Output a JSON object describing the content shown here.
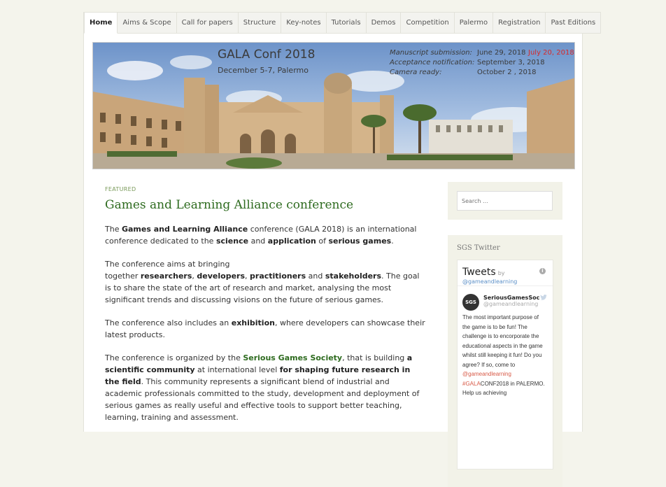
{
  "nav": {
    "items": [
      "Home",
      "Aims & Scope",
      "Call for papers",
      "Structure",
      "Key-notes",
      "Tutorials",
      "Demos",
      "Competition",
      "Palermo",
      "Registration",
      "Past Editions"
    ],
    "active": "Home"
  },
  "banner": {
    "title": "GALA Conf 2018",
    "dates": "December 5-7, Palermo",
    "deadlines": [
      {
        "label": "Manuscript submission:",
        "value": "June 29, 2018",
        "extra": "July 20, 2018"
      },
      {
        "label": "Acceptance notification:",
        "value": "September 3, 2018",
        "extra": ""
      },
      {
        "label": "Camera ready:",
        "value": "October 2 , 2018",
        "extra": ""
      }
    ]
  },
  "post": {
    "category": "FEATURED",
    "title": "Games and Learning Alliance conference",
    "p1": {
      "a": "The ",
      "b": "Games and Learning Alliance",
      "c": " conference (GALA 2018) is an international conference dedicated to the ",
      "d": "science",
      "e": " and ",
      "f": "application",
      "g": " of ",
      "h": "serious games",
      "i": "."
    },
    "p2": {
      "a": "The conference aims at bringing",
      "b": "together ",
      "c": "researchers",
      "d": ", ",
      "e": "developers",
      "f": ", ",
      "g": "practitioners",
      "h": " and ",
      "i": "stakeholders",
      "j": ". The goal is to share the state of the art of research and market, analysing the most significant trends and discussing visions on the future of serious games."
    },
    "p3": {
      "a": "The conference also includes an ",
      "b": "exhibition",
      "c": ", where developers can showcase their latest products."
    },
    "p4": {
      "a": "The conference is organized by the ",
      "b": "Serious Games Society",
      "c": ", that is building ",
      "d": "a scientific community",
      "e": " at international level ",
      "f": "for shaping future research in the field",
      "g": ". This community represents a significant blend of industrial and academic professionals committed to the study, development and deployment of serious games as really useful and effective tools to support better teaching, learning, training and assessment."
    }
  },
  "sidebar": {
    "search_placeholder": "Search ...",
    "twitter_title": "SGS Twitter",
    "tweets_title": "Tweets",
    "tweets_by": "by",
    "tweets_handle": "@gameandlearning",
    "tweet": {
      "avatar": "SGS",
      "name": "SeriousGamesSoc",
      "user": "@gameandlearning",
      "text_a": "The  most important purpose of the game is to be fun! The challenge is to encorporate the educational aspects in the game whilst still keeping it fun! Do you agree? If so, come to ",
      "mention": "@gameandlearning",
      "hashtag": "#GALA",
      "text_b": "CONF2018 in PALERMO. Help us achieving"
    }
  },
  "colors": {
    "accent": "#2e6b1f",
    "banner_red": "#d62a2a"
  }
}
